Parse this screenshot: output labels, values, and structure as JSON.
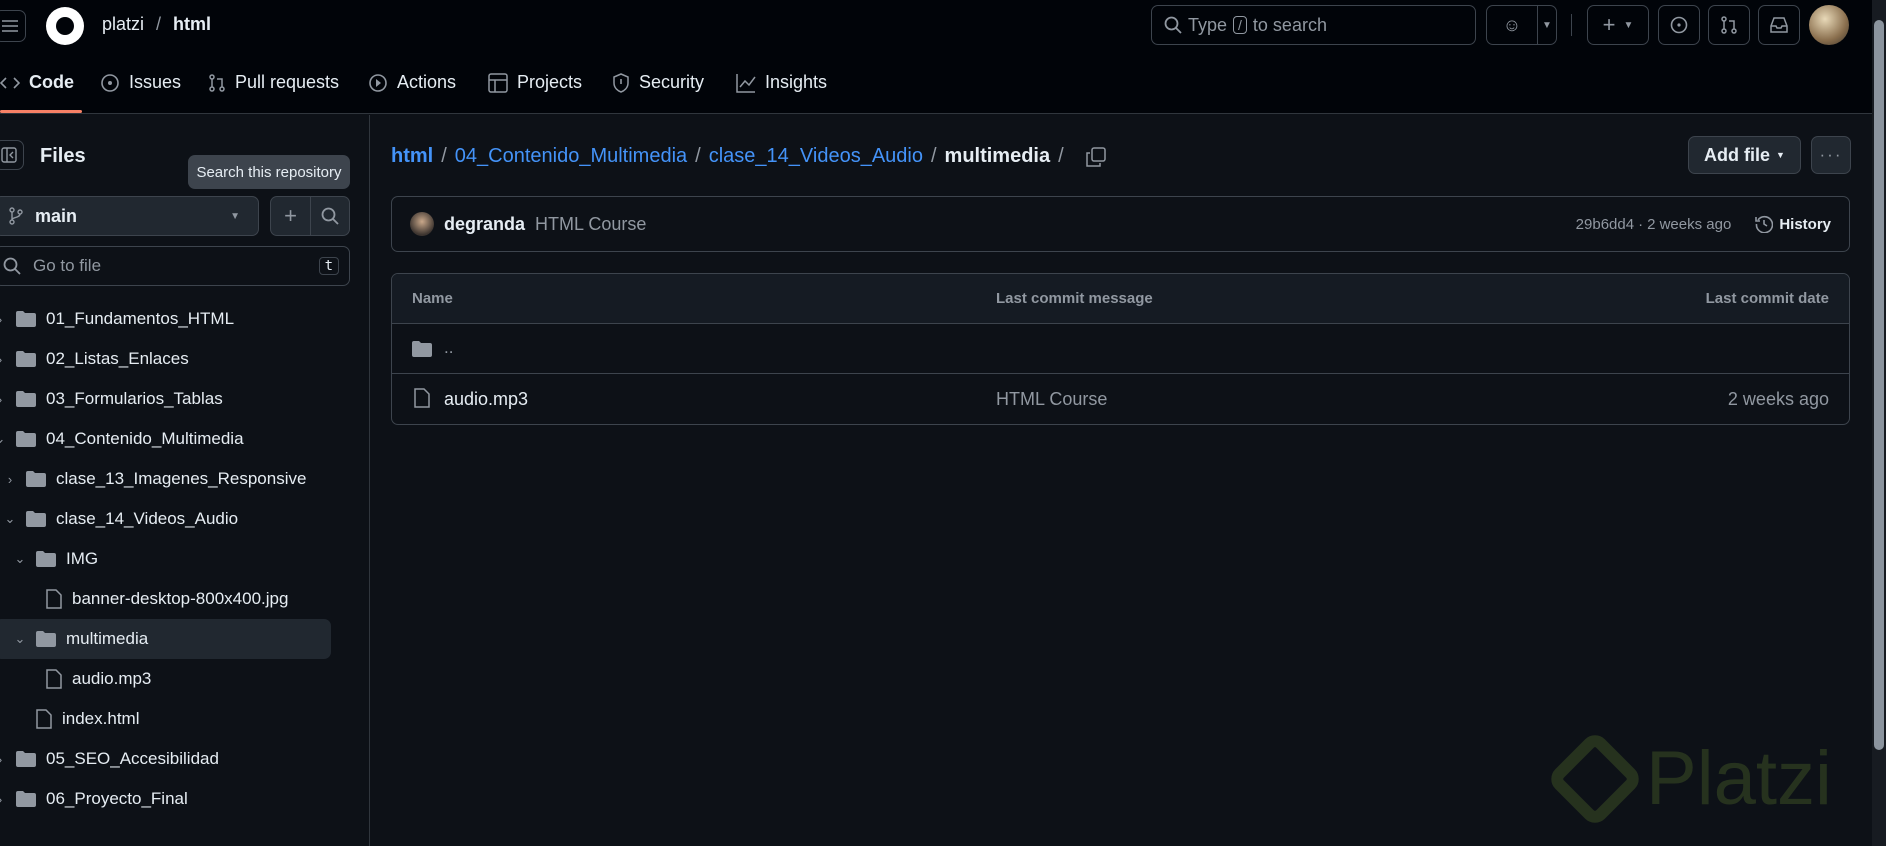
{
  "header": {
    "owner": "platzi",
    "separator": "/",
    "repo": "html",
    "search_placeholder": "Type",
    "search_key": "/",
    "search_suffix": "to search"
  },
  "tabs": [
    {
      "label": "Code",
      "icon": "code-icon"
    },
    {
      "label": "Issues",
      "icon": "issue-icon"
    },
    {
      "label": "Pull requests",
      "icon": "pull-request-icon"
    },
    {
      "label": "Actions",
      "icon": "play-icon"
    },
    {
      "label": "Projects",
      "icon": "table-icon"
    },
    {
      "label": "Security",
      "icon": "shield-icon"
    },
    {
      "label": "Insights",
      "icon": "graph-icon"
    }
  ],
  "sidebar": {
    "title": "Files",
    "branch": "main",
    "go_to_file": "Go to file",
    "shortcut": "t",
    "tooltip": "Search this repository",
    "tree": [
      {
        "label": "01_Fundamentos_HTML",
        "type": "folder",
        "depth": 0,
        "open": false
      },
      {
        "label": "02_Listas_Enlaces",
        "type": "folder",
        "depth": 0,
        "open": false
      },
      {
        "label": "03_Formularios_Tablas",
        "type": "folder",
        "depth": 0,
        "open": false
      },
      {
        "label": "04_Contenido_Multimedia",
        "type": "folder",
        "depth": 0,
        "open": true
      },
      {
        "label": "clase_13_Imagenes_Responsive",
        "type": "folder",
        "depth": 1,
        "open": false
      },
      {
        "label": "clase_14_Videos_Audio",
        "type": "folder",
        "depth": 1,
        "open": true
      },
      {
        "label": "IMG",
        "type": "folder",
        "depth": 2,
        "open": true
      },
      {
        "label": "banner-desktop-800x400.jpg",
        "type": "file",
        "depth": 3
      },
      {
        "label": "multimedia",
        "type": "folder",
        "depth": 2,
        "open": true,
        "selected": true
      },
      {
        "label": "audio.mp3",
        "type": "file",
        "depth": 3
      },
      {
        "label": "index.html",
        "type": "file",
        "depth": 2
      },
      {
        "label": "05_SEO_Accesibilidad",
        "type": "folder",
        "depth": 0,
        "open": false
      },
      {
        "label": "06_Proyecto_Final",
        "type": "folder",
        "depth": 0,
        "open": false
      }
    ]
  },
  "breadcrumb": {
    "parts": [
      "html",
      "04_Contenido_Multimedia",
      "clase_14_Videos_Audio"
    ],
    "current": "multimedia",
    "sep": "/"
  },
  "actions": {
    "add_file": "Add file"
  },
  "commit": {
    "author": "degranda",
    "message": "HTML Course",
    "hash": "29b6dd4",
    "sep": "·",
    "time": "2 weeks ago",
    "history": "History"
  },
  "table": {
    "headers": [
      "Name",
      "Last commit message",
      "Last commit date"
    ],
    "parent": "..",
    "rows": [
      {
        "name": "audio.mp3",
        "message": "HTML Course",
        "date": "2 weeks ago"
      }
    ]
  },
  "watermark": "Platzi",
  "colors": {
    "accent": "#4493f8",
    "bg": "#0d1117",
    "header": "#010409",
    "tab_underline": "#f78166"
  }
}
